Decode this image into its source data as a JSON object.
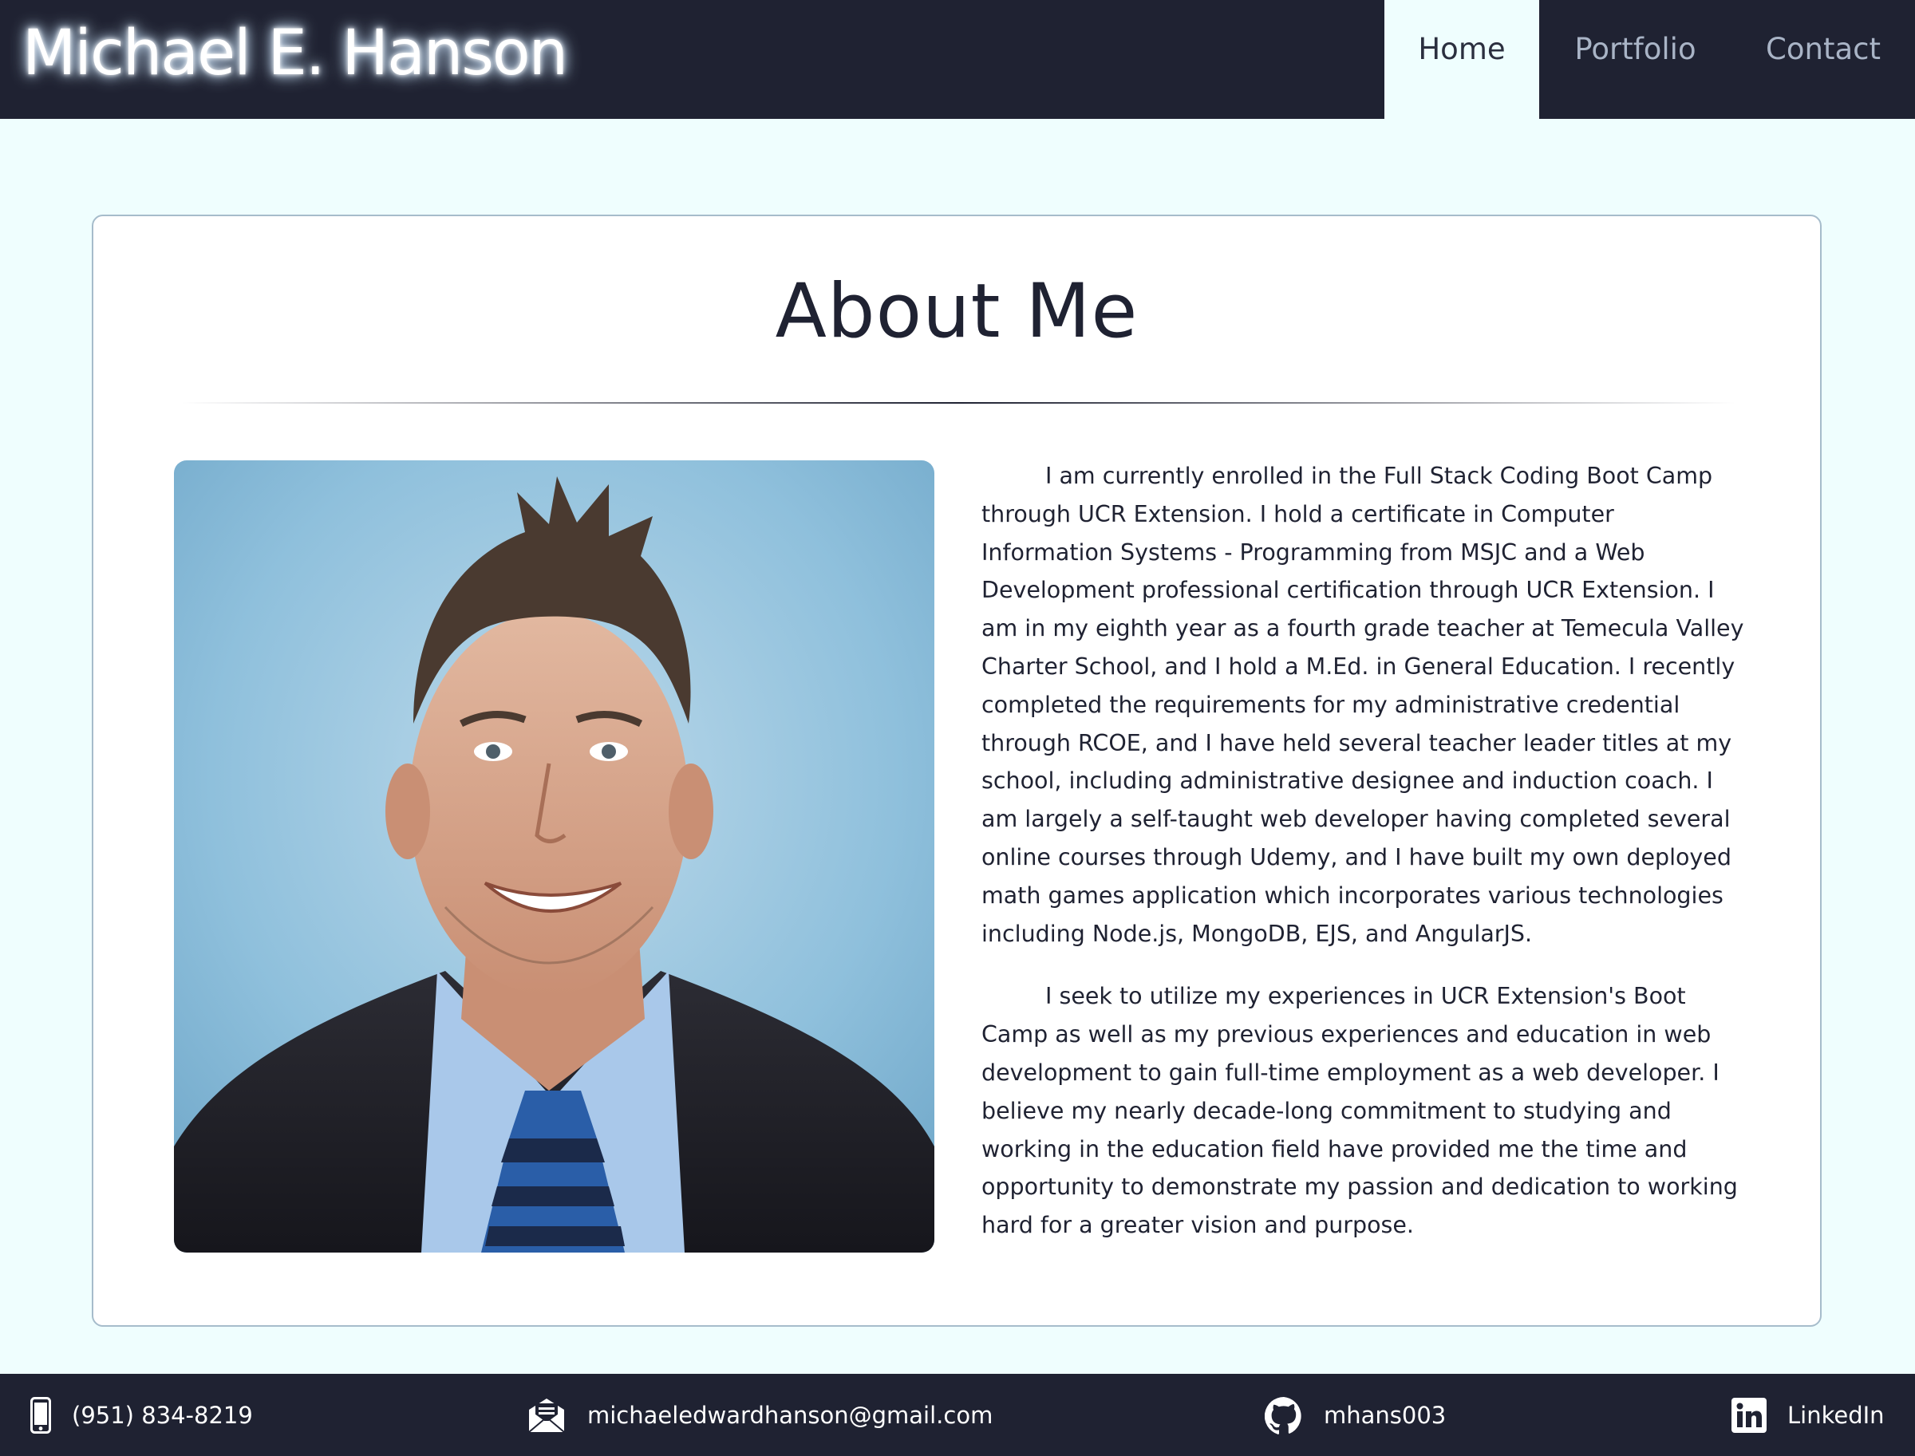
{
  "header": {
    "brand": "Michael E. Hanson",
    "nav": [
      {
        "label": "Home",
        "active": true
      },
      {
        "label": "Portfolio",
        "active": false
      },
      {
        "label": "Contact",
        "active": false
      }
    ]
  },
  "about": {
    "title": "About Me",
    "photo_icon": "profile-photo",
    "paragraphs": [
      "I am currently enrolled in the Full Stack Coding Boot Camp through UCR Extension. I hold a certificate in Computer Information Systems - Programming from MSJC and a Web Development professional certification through UCR Extension. I am in my eighth year as a fourth grade teacher at Temecula Valley Charter School, and I hold a M.Ed. in General Education. I recently completed the requirements for my administrative credential through RCOE, and I have held several teacher leader titles at my school, including administrative designee and induction coach. I am largely a self-taught web developer having completed several online courses through Udemy, and I have built my own deployed math games application which incorporates various technologies including Node.js, MongoDB, EJS, and AngularJS.",
      "I seek to utilize my experiences in UCR Extension's Boot Camp as well as my previous experiences and education in web development to gain full-time employment as a web developer. I believe my nearly decade-long commitment to studying and working in the education field have provided me the time and opportunity to demonstrate my passion and dedication to working hard for a greater vision and purpose."
    ]
  },
  "footer": {
    "phone": {
      "icon": "phone-icon",
      "text": "(951) 834-8219"
    },
    "email": {
      "icon": "email-icon",
      "text": "michaeledwardhanson@gmail.com"
    },
    "github": {
      "icon": "github-icon",
      "text": "mhans003"
    },
    "linkedin": {
      "icon": "linkedin-icon",
      "text": "LinkedIn"
    }
  },
  "colors": {
    "navbar": "#1f2232",
    "page_background": "#effefe",
    "nav_inactive": "#a9b4c6",
    "card_border": "#a6bccb"
  }
}
